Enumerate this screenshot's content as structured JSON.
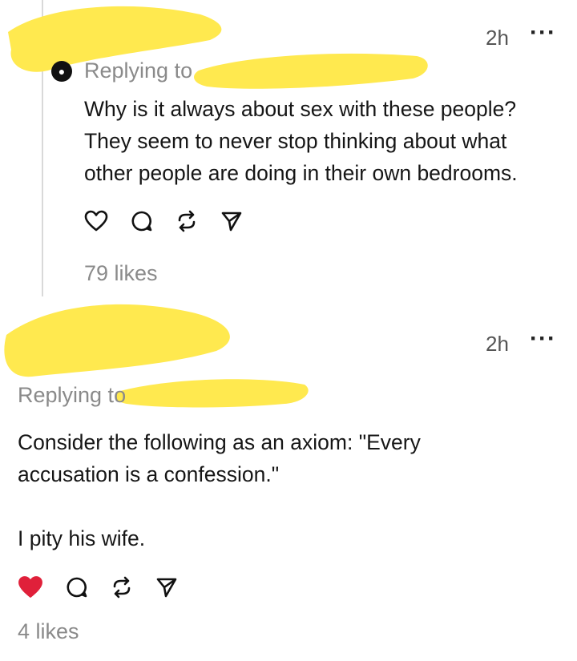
{
  "post1": {
    "time": "2h",
    "more_icon": "ellipsis-icon",
    "replying_label": "Replying to",
    "text": "Why is it always about sex with these people?\nThey seem to never stop thinking about what\nother people are doing in their own bedrooms.",
    "likes": "79 likes",
    "liked": false,
    "actions": [
      "heart-icon",
      "comment-icon",
      "repost-icon",
      "share-icon"
    ]
  },
  "post2": {
    "time": "2h",
    "more_icon": "ellipsis-icon",
    "replying_label": "Replying to",
    "text": "Consider the following as an axiom: \"Every\naccusation is a confession.\"\n\nI pity his wife.",
    "likes": "4 likes",
    "liked": true,
    "actions": [
      "heart-icon",
      "comment-icon",
      "repost-icon",
      "share-icon"
    ]
  },
  "colors": {
    "redaction": "#ffe94f",
    "liked_heart": "#e0203a",
    "meta_text": "#8a8a8a"
  }
}
